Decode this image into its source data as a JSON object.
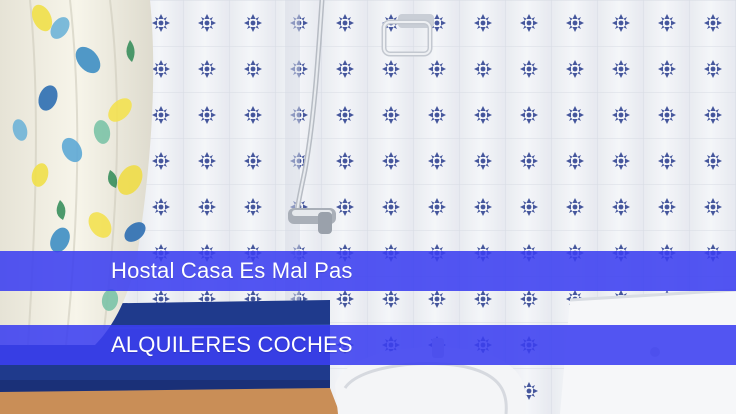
{
  "overlay": {
    "title": "Hostal Casa Es Mal Pas",
    "subtitle": "ALQUILERES COCHES",
    "band_color": "#3b3ff0"
  },
  "photo": {
    "subject": "bathroom",
    "palette": {
      "tile": "#eef1f6",
      "tile_motif": "#2c3f8f",
      "trim": "#1f3a8c",
      "curtain": "#f7f5ea",
      "floor": "#c98e57"
    }
  }
}
